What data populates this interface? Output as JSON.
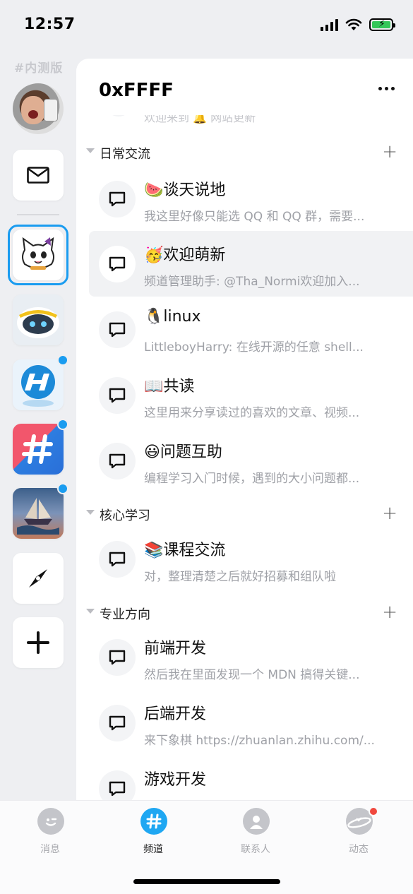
{
  "status_bar": {
    "time": "12:57"
  },
  "rail": {
    "tag": "#内测版",
    "items": [
      {
        "id": "mail",
        "icon": "mail-icon"
      },
      {
        "id": "kitty-guild",
        "icon": "kitty-icon",
        "selected": true
      },
      {
        "id": "robot-guild",
        "icon": "robot-icon"
      },
      {
        "id": "h-guild",
        "icon": "h-logo-icon",
        "badge": true
      },
      {
        "id": "hash-guild",
        "icon": "hash-logo-icon",
        "badge": true
      },
      {
        "id": "ship-guild",
        "icon": "ship-painting-icon",
        "badge": true
      },
      {
        "id": "discover",
        "icon": "compass-icon"
      },
      {
        "id": "add",
        "icon": "plus-icon"
      }
    ]
  },
  "guild": {
    "title": "0xFFFF",
    "peek_text": "欢迎来到 🔔 网站更新"
  },
  "sections": [
    {
      "title": "日常交流",
      "channels": [
        {
          "name": "🍉谈天说地",
          "preview": "我这里好像只能选 QQ 和 QQ 群，需要..."
        },
        {
          "name": "🥳欢迎萌新",
          "preview": "频道管理助手: @Tha_Normi欢迎加入...",
          "active": true
        },
        {
          "name": "🐧linux",
          "preview": "LittleboyHarry: 在线开源的任意 shell..."
        },
        {
          "name": "📖共读",
          "preview": "这里用来分享读过的喜欢的文章、视频..."
        },
        {
          "name": "😃问题互助",
          "preview": "编程学习入门时候，遇到的大小问题都..."
        }
      ]
    },
    {
      "title": "核心学习",
      "channels": [
        {
          "name": "📚课程交流",
          "preview": "对，整理清楚之后就好招募和组队啦"
        }
      ]
    },
    {
      "title": "专业方向",
      "channels": [
        {
          "name": "前端开发",
          "preview": "然后我在里面发现一个 MDN 搞得关键..."
        },
        {
          "name": "后端开发",
          "preview": "来下象棋 https://zhuanlan.zhihu.com/..."
        },
        {
          "name": "游戏开发",
          "preview": ""
        }
      ]
    }
  ],
  "tabbar": {
    "tabs": [
      {
        "label": "消息",
        "icon": "message-face-icon"
      },
      {
        "label": "频道",
        "icon": "channel-hash-icon",
        "active": true
      },
      {
        "label": "联系人",
        "icon": "contacts-icon"
      },
      {
        "label": "动态",
        "icon": "planet-icon",
        "badge": true
      }
    ]
  },
  "colors": {
    "accent": "#1a9cf0",
    "badge_red": "#f0483e"
  }
}
